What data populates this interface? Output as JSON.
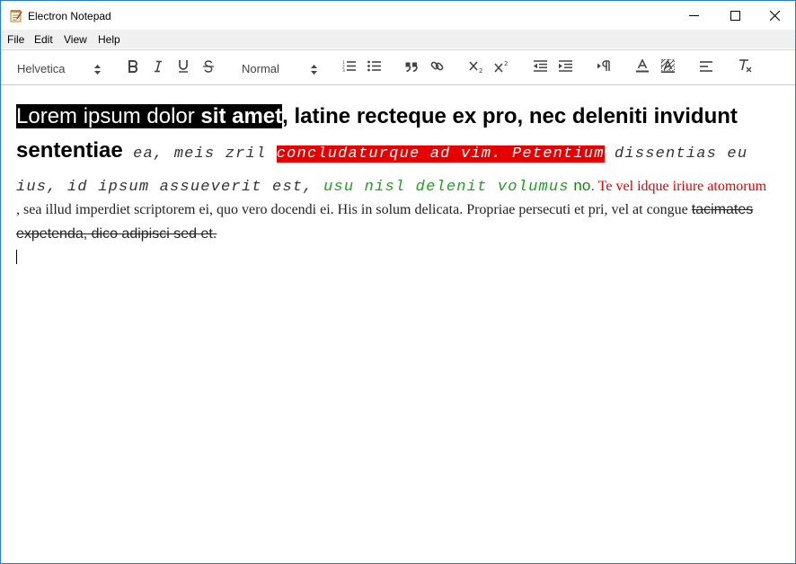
{
  "window": {
    "title": "Electron Notepad",
    "app_icon": "notepad-icon",
    "controls": [
      "minimize-icon",
      "maximize-icon",
      "close-icon"
    ]
  },
  "menu": {
    "items": [
      "File",
      "Edit",
      "View",
      "Help"
    ]
  },
  "toolbar": {
    "font_select": "Helvetica",
    "size_select": "Normal",
    "buttons": [
      "bold",
      "italic",
      "underline",
      "strikethrough",
      "ordered-list",
      "bullet-list",
      "blockquote",
      "link",
      "subscript",
      "superscript",
      "outdent",
      "indent",
      "text-direction",
      "font-color",
      "background-color",
      "align",
      "clean-format"
    ],
    "colors": {
      "accent_border": "#2b7bd6",
      "icon": "#444444"
    }
  },
  "document": {
    "p1": {
      "seg1": "Lorem ipsum dolor ",
      "seg2": "sit amet",
      "seg3": ", latine recteque ex pro, nec deleniti invidunt sententiae",
      "seg4": " ea, meis zril ",
      "seg5": "concludaturque ad vim. Petentium",
      "seg6": " dissentias eu ius, id ipsum assueverit est, ",
      "seg7": "usu nisl delenit volumus",
      "seg8": " no.",
      "seg9": " Te vel idque iriure atomorum",
      "seg10": ", sea illud imperdiet scriptorem ei, quo vero docendi ei. His in solum delicata. Propriae persecuti et pri, vel at congue ",
      "seg11": "tacimates expetenda, dico adipisci sed et."
    },
    "colors": {
      "highlight_black": "#000000",
      "highlight_red": "#e60000",
      "green": "#1f9e1f",
      "red_text": "#e00000"
    }
  }
}
